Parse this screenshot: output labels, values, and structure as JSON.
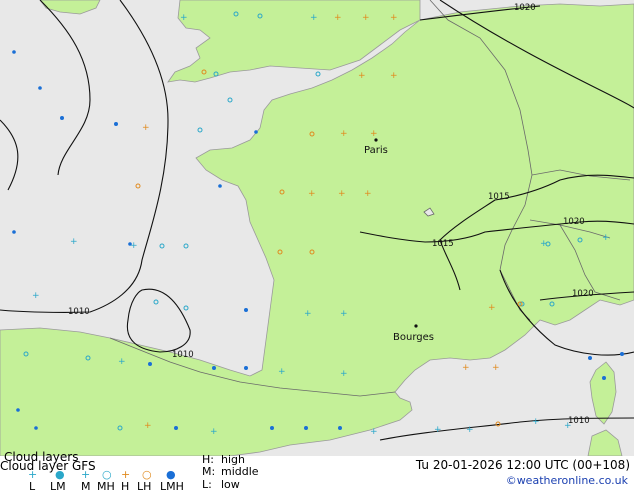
{
  "header": {
    "title": "Cloud layers",
    "model_line": "Cloud layer GFS",
    "datetime": "Tu 20-01-2026 12:00 UTC (00+108)",
    "credit": "©weatheronline.co.uk"
  },
  "legend": {
    "types": [
      {
        "code": "L",
        "symbol": "+",
        "color": "#2aa7c9"
      },
      {
        "code": "LM",
        "symbol": "●",
        "color": "#2aa7c9"
      },
      {
        "code": "M",
        "symbol": "+",
        "color": "#2aa7c9"
      },
      {
        "code": "MH",
        "symbol": "○",
        "color": "#2aa7c9"
      },
      {
        "code": "H",
        "symbol": "+",
        "color": "#e08a1e"
      },
      {
        "code": "LH",
        "symbol": "○",
        "color": "#e08a1e"
      },
      {
        "code": "LMH",
        "symbol": "●",
        "color": "#1a6fd6"
      }
    ],
    "key": [
      {
        "code": "H:",
        "label": "high"
      },
      {
        "code": "M:",
        "label": "middle"
      },
      {
        "code": "L:",
        "label": "low"
      }
    ]
  },
  "map": {
    "colors": {
      "sea": "#e8e8e8",
      "land": "#c4f098",
      "coast": "#9a9a9a",
      "isobar": "#111111",
      "border": "#6a6a6a"
    },
    "isobar_labels": [
      "1020",
      "1015",
      "1015",
      "1020",
      "1020",
      "1010",
      "1010",
      "1010"
    ],
    "cities": [
      {
        "name": "Paris"
      },
      {
        "name": "Bourges"
      }
    ]
  }
}
